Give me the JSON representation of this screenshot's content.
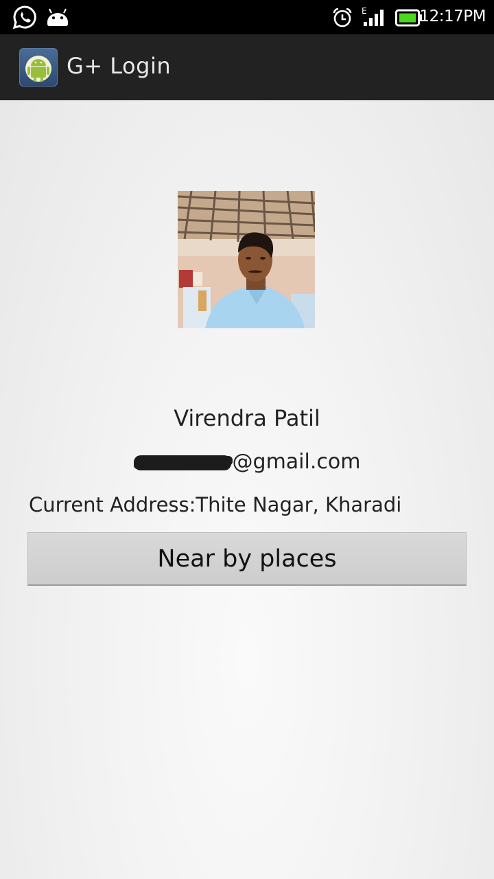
{
  "status_bar": {
    "time": "12:17PM",
    "network_type": "E",
    "icons": [
      "whatsapp-icon",
      "android-notification-icon",
      "alarm-icon",
      "signal-icon",
      "battery-icon"
    ]
  },
  "action_bar": {
    "title": "G+ Login",
    "app_icon": "android-app-icon"
  },
  "profile": {
    "name": "Virendra Patil",
    "email_domain": "@gmail.com",
    "address": "Current Address:Thite Nagar, Kharadi"
  },
  "actions": {
    "nearby_label": "Near by places"
  },
  "colors": {
    "status_bar_bg": "#000000",
    "action_bar_bg": "#222222",
    "button_bg": "#d4d4d4",
    "battery_green": "#4cd81f"
  }
}
